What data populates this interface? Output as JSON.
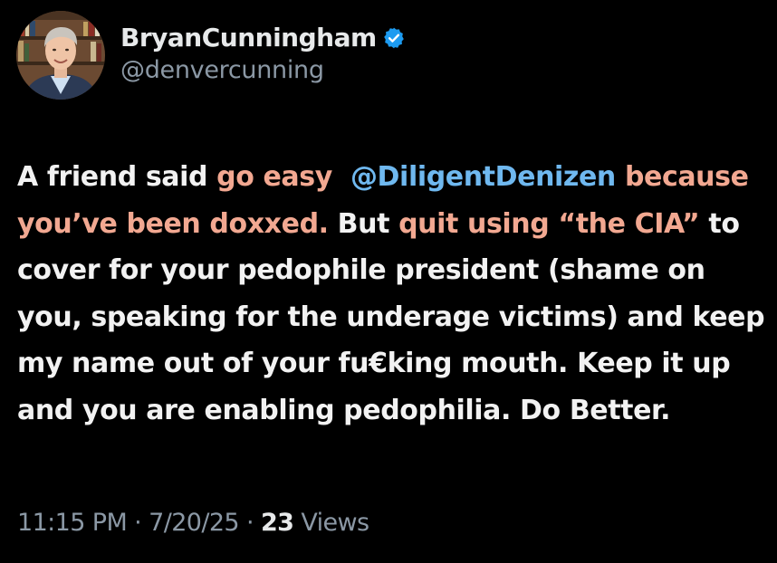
{
  "post": {
    "author": {
      "display_name": "BryanCunningham",
      "handle": "@denvercunning",
      "verified": true
    },
    "body": {
      "s1": "A friend said ",
      "s2": "go easy",
      "s3": "  ",
      "s4": "@DiligentDenizen",
      "s5": " ",
      "s6": "because you’ve been doxxed.",
      "s7": " But ",
      "s8": "quit using “the CIA”",
      "s9": " to cover for your pedophile president (shame on you, speaking for the underage victims) and keep my name out of your fu€king mouth. Keep it up and you are enabling pedophilia. Do Better."
    },
    "meta": {
      "time": "11:15 PM",
      "sep1": " · ",
      "date": "7/20/25",
      "sep2": " · ",
      "views_count": "23",
      "views_label": " Views"
    }
  },
  "colors": {
    "background": "#000000",
    "text": "#e7e9ea",
    "secondary": "#8b98a5",
    "highlight": "#f2a891",
    "mention": "#6fb8ef",
    "verified_badge": "#1d9bf0"
  },
  "icons": {
    "verified": "verified-badge-icon",
    "avatar": "avatar-photo"
  }
}
